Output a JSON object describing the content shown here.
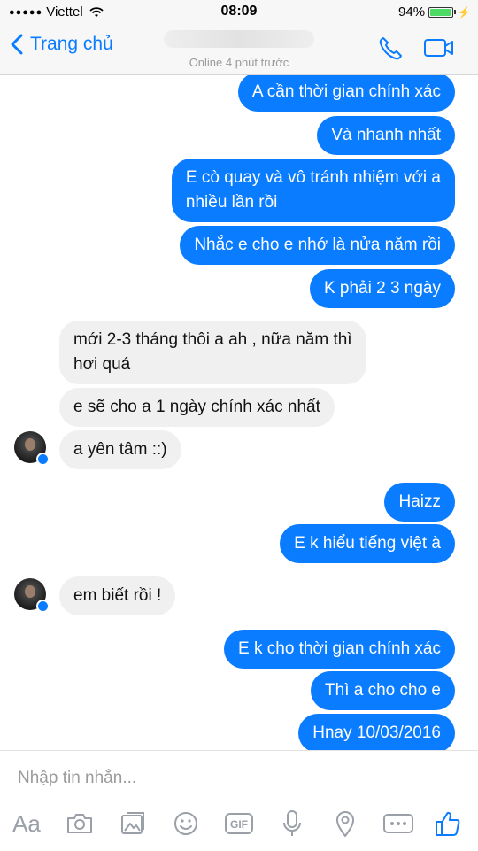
{
  "status_bar": {
    "carrier": "Viettel",
    "time": "08:09",
    "battery_percent": "94%",
    "battery_level": 0.94
  },
  "header": {
    "back_label": "Trang chủ",
    "status": "Online 4 phút trước"
  },
  "messages": [
    {
      "text": "A cần thời gian chính xác",
      "direction": "sent"
    },
    {
      "text": "Và nhanh nhất",
      "direction": "sent"
    },
    {
      "text": "E cò quay và vô tránh nhiệm với a nhiều lần rồi",
      "lines": [
        "E cò quay và vô tránh nhiệm với a",
        "nhiều lần rồi"
      ],
      "direction": "sent"
    },
    {
      "text": "Nhắc e cho e nhớ là nửa năm rồi",
      "direction": "sent"
    },
    {
      "text": "K phải 2 3 ngày",
      "direction": "sent"
    },
    {
      "text": "mới 2-3 tháng thôi a ah , nữa năm thì hơi quá",
      "lines": [
        "mới 2-3 tháng thôi a ah , nữa năm thì",
        "hơi quá"
      ],
      "direction": "received"
    },
    {
      "text": "e sẽ cho a 1 ngày chính xác nhất",
      "direction": "received"
    },
    {
      "text": "a yên tâm ::)",
      "direction": "received"
    },
    {
      "text": "Haizz",
      "direction": "sent"
    },
    {
      "text": "E k hiểu tiếng việt à",
      "direction": "sent"
    },
    {
      "text": "em biết rồi !",
      "direction": "received"
    },
    {
      "text": "E k cho thời gian chính xác",
      "direction": "sent"
    },
    {
      "text": "Thì a cho cho e",
      "direction": "sent"
    },
    {
      "text": "Hnay 10/03/2016",
      "direction": "sent"
    }
  ],
  "composer": {
    "placeholder": "Nhập tin nhắn...",
    "aa_label": "Aa",
    "gif_label": "GIF",
    "tools": [
      "aa-text",
      "camera-icon",
      "photo-icon",
      "emoji-icon",
      "gif-icon",
      "microphone-icon",
      "location-icon",
      "more-icon",
      "like-icon"
    ]
  },
  "colors": {
    "accent": "#0a7cff",
    "incoming_bubble": "#f1f0f0",
    "outgoing_text": "#ffffff",
    "icon_gray": "#9a9fa8"
  }
}
